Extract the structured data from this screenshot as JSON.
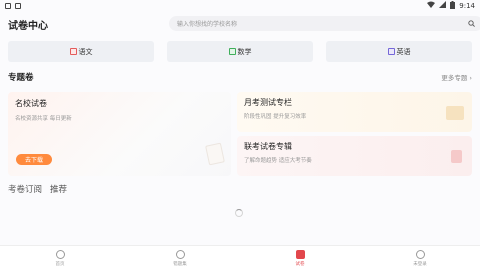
{
  "status_bar": {
    "time": "9:14"
  },
  "header": {
    "title": "试卷中心",
    "search_placeholder": "输入你想找的学校名称"
  },
  "subjects": [
    {
      "label": "语文",
      "icon": "chinese-icon",
      "color": "#e45b5b"
    },
    {
      "label": "数学",
      "icon": "math-icon",
      "color": "#3fae5b"
    },
    {
      "label": "英语",
      "icon": "english-icon",
      "color": "#7567d8"
    }
  ],
  "section": {
    "title": "专题卷",
    "more": "更多专题 ›"
  },
  "featured": {
    "title": "名校试卷",
    "subtitle": "名校资源共享 每日更新",
    "button": "去下载"
  },
  "cards": [
    {
      "title": "月考测试专栏",
      "subtitle": "阶段性巩固 提升复习效率"
    },
    {
      "title": "联考试卷专辑",
      "subtitle": "了解命题趋势 适应大考节奏"
    }
  ],
  "tabs": [
    "考卷订阅",
    "推荐"
  ],
  "bottom_nav": [
    {
      "label": "首页",
      "active": false
    },
    {
      "label": "错题集",
      "active": false
    },
    {
      "label": "试卷",
      "active": true
    },
    {
      "label": "未登录",
      "active": false
    }
  ],
  "colors": {
    "accent": "#e2474c",
    "download_button": "#ff8a3d"
  }
}
